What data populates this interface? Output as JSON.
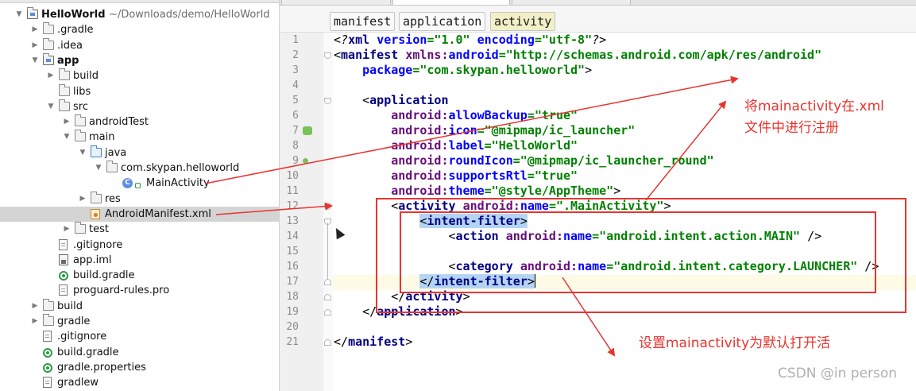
{
  "tree": {
    "rows": [
      {
        "label": "HelloWorld",
        "path": "~/Downloads/demo/HelloWorld",
        "bold": true
      },
      {
        "label": ".gradle"
      },
      {
        "label": ".idea"
      },
      {
        "label": "app",
        "bold": true
      },
      {
        "label": "build"
      },
      {
        "label": "libs"
      },
      {
        "label": "src"
      },
      {
        "label": "androidTest"
      },
      {
        "label": "main"
      },
      {
        "label": "java"
      },
      {
        "label": "com.skypan.helloworld"
      },
      {
        "label": "MainActivity"
      },
      {
        "label": "res"
      },
      {
        "label": "AndroidManifest.xml"
      },
      {
        "label": "test"
      },
      {
        "label": ".gitignore"
      },
      {
        "label": "app.iml"
      },
      {
        "label": "build.gradle"
      },
      {
        "label": "proguard-rules.pro"
      },
      {
        "label": "build"
      },
      {
        "label": "gradle"
      },
      {
        "label": ".gitignore"
      },
      {
        "label": "build.gradle"
      },
      {
        "label": "gradle.properties"
      },
      {
        "label": "gradlew"
      }
    ]
  },
  "breadcrumbs": [
    "manifest",
    "application",
    "activity"
  ],
  "editor": {
    "line_numbers": [
      "1",
      "2",
      "3",
      "4",
      "5",
      "6",
      "7",
      "8",
      "9",
      "10",
      "11",
      "12",
      "13",
      "14",
      "15",
      "16",
      "17",
      "18",
      "19",
      "20",
      "21"
    ]
  },
  "annotations": {
    "register_note_line1": "将mainactivity在.xml",
    "register_note_line2": "文件中进行注册",
    "launcher_note": "设置mainactivity为默认打开活",
    "watermark": "CSDN @in person"
  },
  "colors": {
    "annotation_red": "#e8342f",
    "tag_blue": "#000080",
    "attr_blue": "#0000ff",
    "namespace_purple": "#660e7a",
    "value_green": "#008000",
    "selection_blue": "#b4d4f4"
  }
}
